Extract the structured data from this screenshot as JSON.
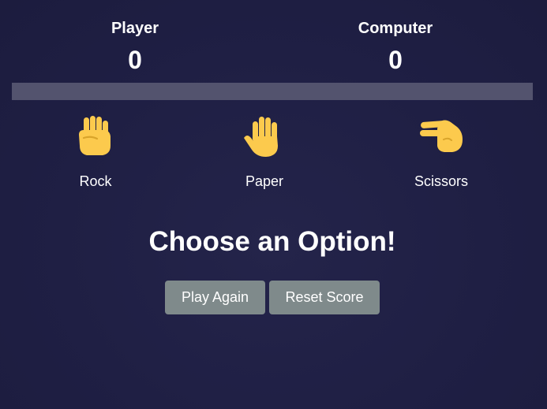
{
  "scoreboard": {
    "player_label": "Player",
    "player_score": "0",
    "computer_label": "Computer",
    "computer_score": "0"
  },
  "choices": [
    {
      "label": "Rock",
      "icon": "raised-fist-icon"
    },
    {
      "label": "Paper",
      "icon": "raised-hand-icon"
    },
    {
      "label": "Scissors",
      "icon": "victory-hand-icon"
    }
  ],
  "message": "Choose an Option!",
  "buttons": {
    "play_again": "Play Again",
    "reset_score": "Reset Score"
  },
  "colors": {
    "background": "#1f1f44",
    "bar": "#53536e",
    "button": "#7f8a8b",
    "icon": "#fcca4d"
  }
}
